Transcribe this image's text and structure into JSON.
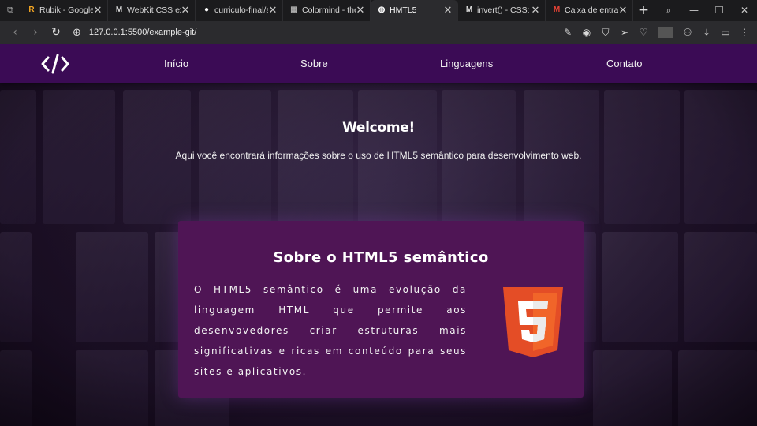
{
  "browser": {
    "tabs": [
      {
        "favicon": "rubik-icon",
        "favicon_glyph": "R",
        "favicon_color": "#f4a623",
        "title": "Rubik - Google F"
      },
      {
        "favicon": "mdn-icon",
        "favicon_glyph": "M",
        "favicon_color": "#dddddd",
        "title": "WebKit CSS exte"
      },
      {
        "favicon": "github-icon",
        "favicon_glyph": "●",
        "favicon_color": "#ffffff",
        "title": "curriculo-final/st"
      },
      {
        "favicon": "colormind-icon",
        "favicon_glyph": "▦",
        "favicon_color": "#aaaaaa",
        "title": "Colormind - the"
      },
      {
        "favicon": "globe-icon",
        "favicon_glyph": "◍",
        "favicon_color": "#ffffff",
        "title": "HMTL5"
      },
      {
        "favicon": "mdn-icon",
        "favicon_glyph": "M",
        "favicon_color": "#dddddd",
        "title": "invert() - CSS: Ca"
      },
      {
        "favicon": "gmail-icon",
        "favicon_glyph": "M",
        "favicon_color": "#ea4335",
        "title": "Caixa de entrada"
      }
    ],
    "active_tab_index": 4,
    "url": "127.0.0.1:5500/example-git/"
  },
  "site": {
    "nav_links": [
      "Início",
      "Sobre",
      "Linguagens",
      "Contato"
    ],
    "welcome_title": "Welcome!",
    "welcome_text": "Aqui você encontrará informações sobre o uso de HTML5 semântico para desenvolvimento web.",
    "card_title": "Sobre o HTML5 semântico",
    "card_text": "O HTML5 semântico é uma evolução da linguagem HTML que permite aos desenvovedores criar estruturas mais significativas e ricas em conteúdo para seus sites e aplicativos."
  },
  "colors": {
    "nav_bg": "#3b0b55",
    "card_bg": "#4f1555",
    "html5_orange": "#e44d26",
    "html5_light": "#f16529"
  }
}
